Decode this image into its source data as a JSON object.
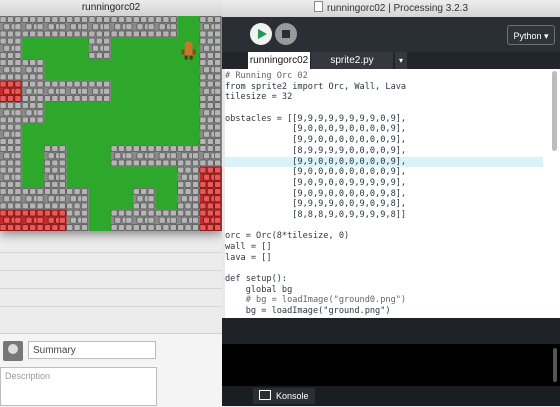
{
  "sketch": {
    "title": "runningorc02"
  },
  "ide": {
    "title": "runningorc02 | Processing 3.2.3",
    "mode": "Python ▾",
    "tabs": [
      "runningorc02",
      "sprite2.py",
      "▾"
    ],
    "console_tab": "Konsole"
  },
  "panel": {
    "summary_value": "Summary",
    "description_placeholder": "Description"
  },
  "code_lines": [
    {
      "cls": "c-comment",
      "text": "# Running Orc 02"
    },
    {
      "cls": "",
      "text": "from sprite2 import Orc, Wall, Lava"
    },
    {
      "cls": "",
      "text": "tilesize = 32"
    },
    {
      "cls": "",
      "text": ""
    },
    {
      "cls": "",
      "text": "obstacles = [[9,9,9,9,9,9,9,9,0,9],"
    },
    {
      "cls": "",
      "text": "             [9,0,0,0,9,0,0,0,0,9],"
    },
    {
      "cls": "",
      "text": "             [9,9,0,0,0,0,0,0,0,9],"
    },
    {
      "cls": "",
      "text": "             [8,9,9,9,9,0,0,0,0,9],"
    },
    {
      "cls": "hl",
      "text": "             [9,9,0,0,0,0,0,0,0,9],"
    },
    {
      "cls": "",
      "text": "             [9,0,0,0,0,0,0,0,0,9],"
    },
    {
      "cls": "",
      "text": "             [9,0,9,0,0,9,9,9,9,9],"
    },
    {
      "cls": "",
      "text": "             [9,0,9,0,0,0,0,0,9,8],"
    },
    {
      "cls": "",
      "text": "             [9,9,9,9,0,0,9,0,9,8],"
    },
    {
      "cls": "",
      "text": "             [8,8,8,9,0,9,9,9,9,8]]"
    },
    {
      "cls": "",
      "text": ""
    },
    {
      "cls": "",
      "text": "orc = Orc(8*tilesize, 0)"
    },
    {
      "cls": "",
      "text": "wall = []"
    },
    {
      "cls": "",
      "text": "lava = []"
    },
    {
      "cls": "",
      "text": ""
    },
    {
      "cls": "",
      "text": "def setup():"
    },
    {
      "cls": "",
      "text": "    global bg"
    },
    {
      "cls": "c-comment",
      "text": "    # bg = loadImage(\"ground0.png\")"
    },
    {
      "cls": "",
      "text": "    bg = loadImage(\"ground.png\")"
    }
  ],
  "map": [
    [
      9,
      9,
      9,
      9,
      9,
      9,
      9,
      9,
      0,
      9
    ],
    [
      9,
      0,
      0,
      0,
      9,
      0,
      0,
      0,
      0,
      9
    ],
    [
      9,
      9,
      0,
      0,
      0,
      0,
      0,
      0,
      0,
      9
    ],
    [
      8,
      9,
      9,
      9,
      9,
      0,
      0,
      0,
      0,
      9
    ],
    [
      9,
      9,
      0,
      0,
      0,
      0,
      0,
      0,
      0,
      9
    ],
    [
      9,
      0,
      0,
      0,
      0,
      0,
      0,
      0,
      0,
      9
    ],
    [
      9,
      0,
      9,
      0,
      0,
      9,
      9,
      9,
      9,
      9
    ],
    [
      9,
      0,
      9,
      0,
      0,
      0,
      0,
      0,
      9,
      8
    ],
    [
      9,
      9,
      9,
      9,
      0,
      0,
      9,
      0,
      9,
      8
    ],
    [
      8,
      8,
      8,
      9,
      0,
      9,
      9,
      9,
      9,
      8
    ]
  ],
  "colors": {
    "grass": "#2ea82b",
    "stone": "#8a8a8a",
    "lava": "#c42a2a",
    "orc": "#c8782a"
  }
}
